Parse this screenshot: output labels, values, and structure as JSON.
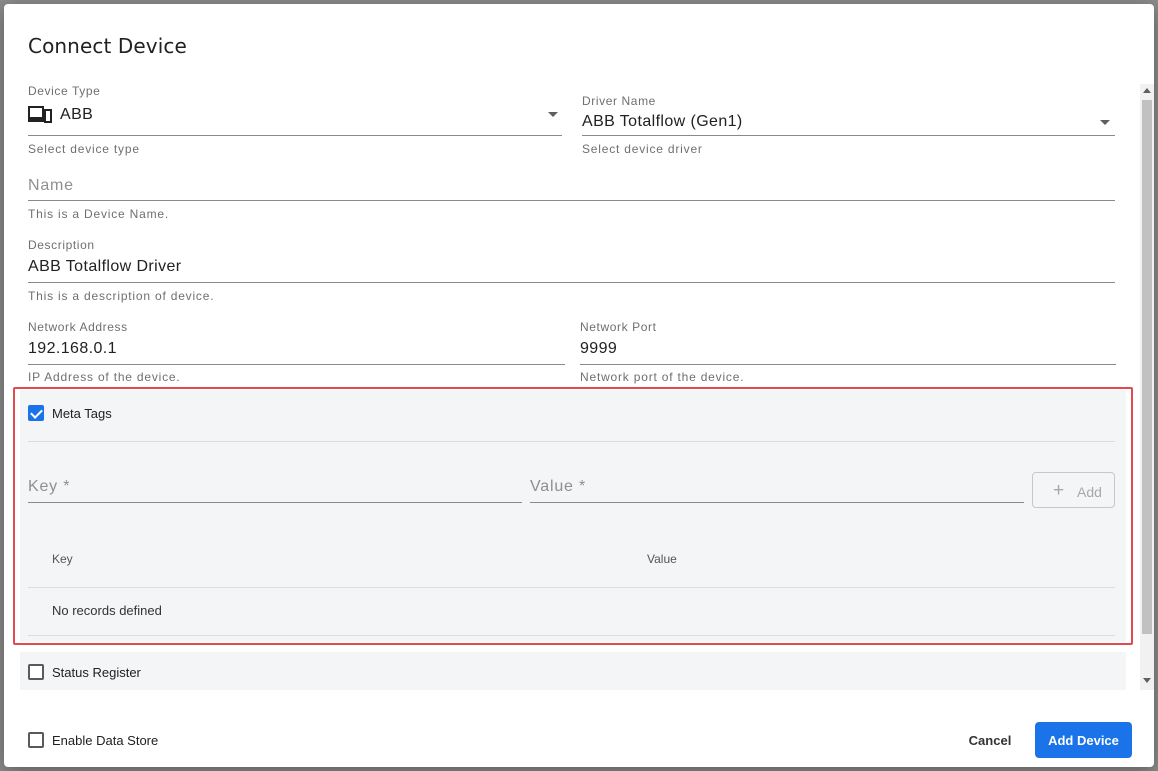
{
  "dialog": {
    "title": "Connect Device"
  },
  "device_type": {
    "label": "Device Type",
    "value": "ABB",
    "hint": "Select device type",
    "icon": "devices-icon"
  },
  "driver_name": {
    "label": "Driver Name",
    "value": "ABB Totalflow (Gen1)",
    "hint": "Select device driver"
  },
  "name_field": {
    "placeholder": "Name",
    "hint": "This is a Device Name."
  },
  "description": {
    "label": "Description",
    "value": "ABB Totalflow Driver",
    "hint": "This is a description of device."
  },
  "network_address": {
    "label": "Network Address",
    "value": "192.168.0.1",
    "hint": "IP Address of the device."
  },
  "network_port": {
    "label": "Network Port",
    "value": "9999",
    "hint": "Network port of the device."
  },
  "meta_tags": {
    "label": "Meta Tags",
    "checked": true,
    "key_placeholder": "Key *",
    "value_placeholder": "Value *",
    "add_label": "Add",
    "columns": [
      "Key",
      "Value"
    ],
    "empty_text": "No records defined"
  },
  "status_register": {
    "label": "Status Register",
    "checked": false
  },
  "footer": {
    "enable_data_store": "Enable Data Store",
    "cancel_label": "Cancel",
    "submit_label": "Add Device"
  },
  "colors": {
    "primary": "#1a73e8",
    "highlight": "#e34a4f",
    "section_bg": "#f3f5f7"
  }
}
